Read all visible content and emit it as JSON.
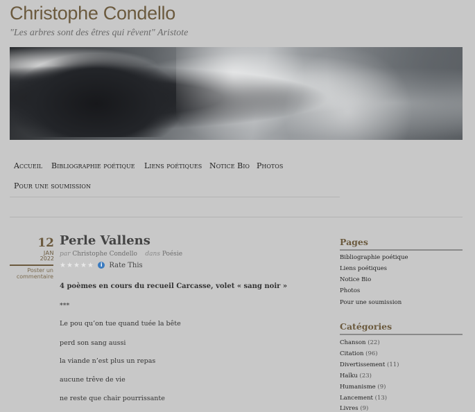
{
  "site": {
    "title": "Christophe Condello",
    "tagline": "\"Les arbres sont des êtres qui rêvent\" Aristote"
  },
  "nav": {
    "items": [
      {
        "label": "Accueil"
      },
      {
        "label": "Bibliographie poétique"
      },
      {
        "label": "Liens poétiques"
      },
      {
        "label": "Notice Bio"
      },
      {
        "label": "Photos"
      },
      {
        "label": "Pour une soumission"
      }
    ]
  },
  "post": {
    "date": {
      "day": "12",
      "month": "JAN",
      "year": "2022"
    },
    "comment_link": "Poster un commentaire",
    "title": "Perle Vallens",
    "meta": {
      "by": "par",
      "author": "Christophe Condello",
      "in": "dans",
      "category": "Poésie"
    },
    "rating_label": "Rate This",
    "info_glyph": "i",
    "star_glyph": "★",
    "lines": [
      "4 poèmes en cours du recueil Carcasse, volet « sang noir »",
      "***",
      "Le pou qu’on tue quand tuée la bête",
      "perd son sang aussi",
      "la viande n’est plus un repas",
      "aucune trêve de vie",
      "ne reste que chair pourrissante"
    ]
  },
  "sidebar": {
    "pages": {
      "heading": "Pages",
      "items": [
        "Bibliographie poétique",
        "Liens poétiques",
        "Notice Bio",
        "Photos",
        "Pour une soumission"
      ]
    },
    "categories": {
      "heading": "Catégories",
      "items": [
        {
          "label": "Chanson",
          "count": "(22)"
        },
        {
          "label": "Citation",
          "count": "(96)"
        },
        {
          "label": "Divertissement",
          "count": "(11)"
        },
        {
          "label": "Haïku",
          "count": "(23)"
        },
        {
          "label": "Humanisme",
          "count": "(9)"
        },
        {
          "label": "Lancement",
          "count": "(13)"
        },
        {
          "label": "Livres",
          "count": "(9)"
        }
      ]
    }
  }
}
